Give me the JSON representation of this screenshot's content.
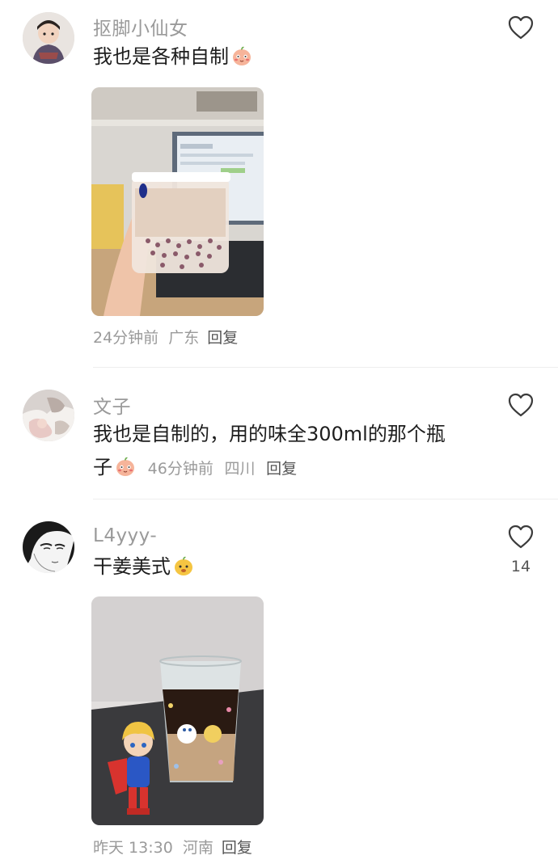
{
  "comments": [
    {
      "username": "抠脚小仙女",
      "text": "我也是各种自制",
      "time": "24分钟前",
      "location": "广东",
      "reply_label": "回复",
      "like_count": ""
    },
    {
      "username": "文子",
      "text_line1": "我也是自制的，用的味全300ml的那个瓶",
      "text_line2": "子",
      "time": "46分钟前",
      "location": "四川",
      "reply_label": "回复",
      "like_count": ""
    },
    {
      "username": "L4yyy-",
      "text": "干姜美式",
      "time": "昨天 13:30",
      "location": "河南",
      "reply_label": "回复",
      "like_count": "14"
    }
  ],
  "icons": {
    "like": "heart-outline-icon",
    "emoji_blush": "peach-blush-emoji",
    "emoji_happy": "yellow-face-emoji"
  },
  "colors": {
    "username": "#9a9a9a",
    "text": "#1d1d1d",
    "meta": "#9a9a9a"
  }
}
